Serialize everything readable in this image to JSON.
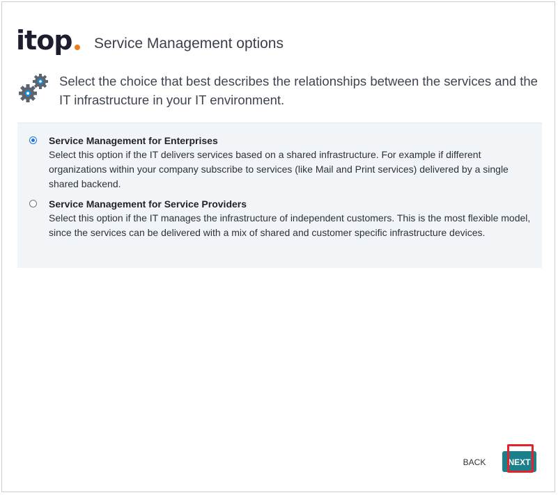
{
  "header": {
    "logo_text": "itop",
    "title": "Service Management options"
  },
  "intro": {
    "icon": "gears-icon",
    "text": "Select the choice that best describes the relationships between the services and the IT infrastructure in your IT environment."
  },
  "options": [
    {
      "title": "Service Management for Enterprises",
      "description": "Select this option if the IT delivers services based on a shared infrastructure. For example if different organizations within your company subscribe to services (like Mail and Print services) delivered by a single shared backend.",
      "selected": true
    },
    {
      "title": "Service Management for Service Providers",
      "description": "Select this option if the IT manages the infrastructure of independent customers. This is the most flexible model, since the services can be delivered with a mix of shared and customer specific infrastructure devices.",
      "selected": false
    }
  ],
  "footer": {
    "back_label": "BACK",
    "next_label": "NEXT"
  },
  "colors": {
    "accent": "#1b7f8c",
    "logo_dot": "#ea7d1e",
    "highlight": "#e3222b",
    "radio_selected": "#1a73e8"
  }
}
